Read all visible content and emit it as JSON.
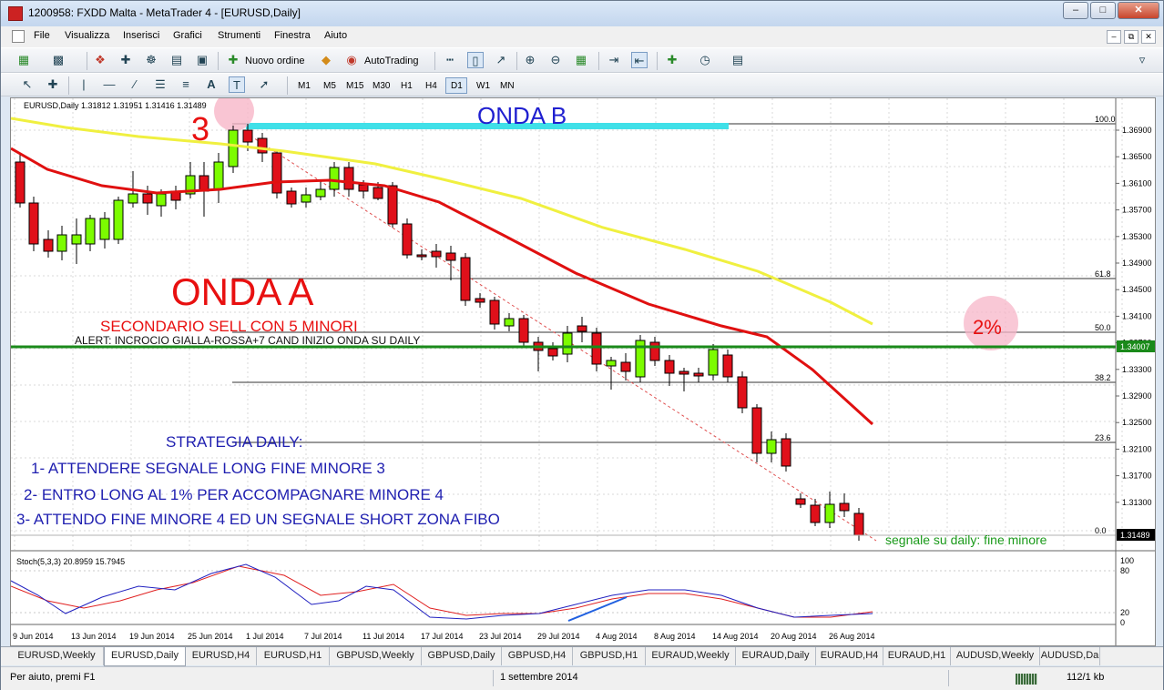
{
  "window": {
    "title": "1200958: FXDD Malta - MetaTrader 4 - [EURUSD,Daily]"
  },
  "menu": [
    "File",
    "Visualizza",
    "Inserisci",
    "Grafici",
    "Strumenti",
    "Finestra",
    "Aiuto"
  ],
  "toolbar": {
    "new_order": "Nuovo ordine",
    "autotrading": "AutoTrading"
  },
  "timeframes": [
    "M1",
    "M5",
    "M15",
    "M30",
    "H1",
    "H4",
    "D1",
    "W1",
    "MN"
  ],
  "chart": {
    "header": "EURUSD,Daily  1.31812 1.31951 1.31416 1.31489",
    "price_labels": [
      "1.36900",
      "1.36500",
      "1.36100",
      "1.35700",
      "1.35300",
      "1.34900",
      "1.34500",
      "1.34100",
      "1.33700",
      "1.33300",
      "1.32900",
      "1.32500",
      "1.32100",
      "1.31700",
      "1.31300"
    ],
    "hline_price": "1.34007",
    "current_price": "1.31489",
    "fibo_levels": [
      "100.0",
      "61.8",
      "50.0",
      "38.2",
      "23.6",
      "0.0"
    ],
    "date_labels": [
      "9 Jun 2014",
      "13 Jun 2014",
      "19 Jun 2014",
      "25 Jun 2014",
      "1 Jul 2014",
      "7 Jul 2014",
      "11 Jul 2014",
      "17 Jul 2014",
      "23 Jul 2014",
      "29 Jul 2014",
      "4 Aug 2014",
      "8 Aug 2014",
      "14 Aug 2014",
      "20 Aug 2014",
      "26 Aug 2014"
    ],
    "stoch_header": "Stoch(5,3,3) 20.8959 15.7945",
    "stoch_levels": [
      "100",
      "80",
      "20",
      "0"
    ],
    "annotations": {
      "onda_b": "ONDA B",
      "three": "3",
      "onda_a": "ONDA A",
      "secondario": "SECONDARIO SELL CON 5 MINORI",
      "alert": "ALERT: INCROCIO GIALLA-ROSSA+7 CAND INIZIO ONDA SU DAILY",
      "percent": "2%",
      "strategia": "STRATEGIA DAILY:",
      "step1": "1- ATTENDERE SEGNALE LONG FINE MINORE 3",
      "step2": "2- ENTRO LONG AL 1% PER ACCOMPAGNARE MINORE 4",
      "step3": "3- ATTENDO FINE MINORE 4 ED UN SEGNALE SHORT ZONA FIBO",
      "segnale": "segnale su daily: fine minore"
    }
  },
  "tabs": [
    "EURUSD,Weekly",
    "EURUSD,Daily",
    "EURUSD,H4",
    "EURUSD,H1",
    "GBPUSD,Weekly",
    "GBPUSD,Daily",
    "GBPUSD,H4",
    "GBPUSD,H1",
    "EURAUD,Weekly",
    "EURAUD,Daily",
    "EURAUD,H4",
    "EURAUD,H1",
    "AUDUSD,Weekly",
    "AUDUSD,Da"
  ],
  "status": {
    "help": "Per aiuto, premi F1",
    "date": "1 settembre 2014",
    "traffic": "112/1 kb"
  },
  "colors": {
    "bull": "#7cfc00",
    "bear": "#e0101a",
    "ma_fast": "#e01010",
    "ma_slow": "#f0f040",
    "hline": "#1a8a1a",
    "cyan": "#40e0e8"
  }
}
